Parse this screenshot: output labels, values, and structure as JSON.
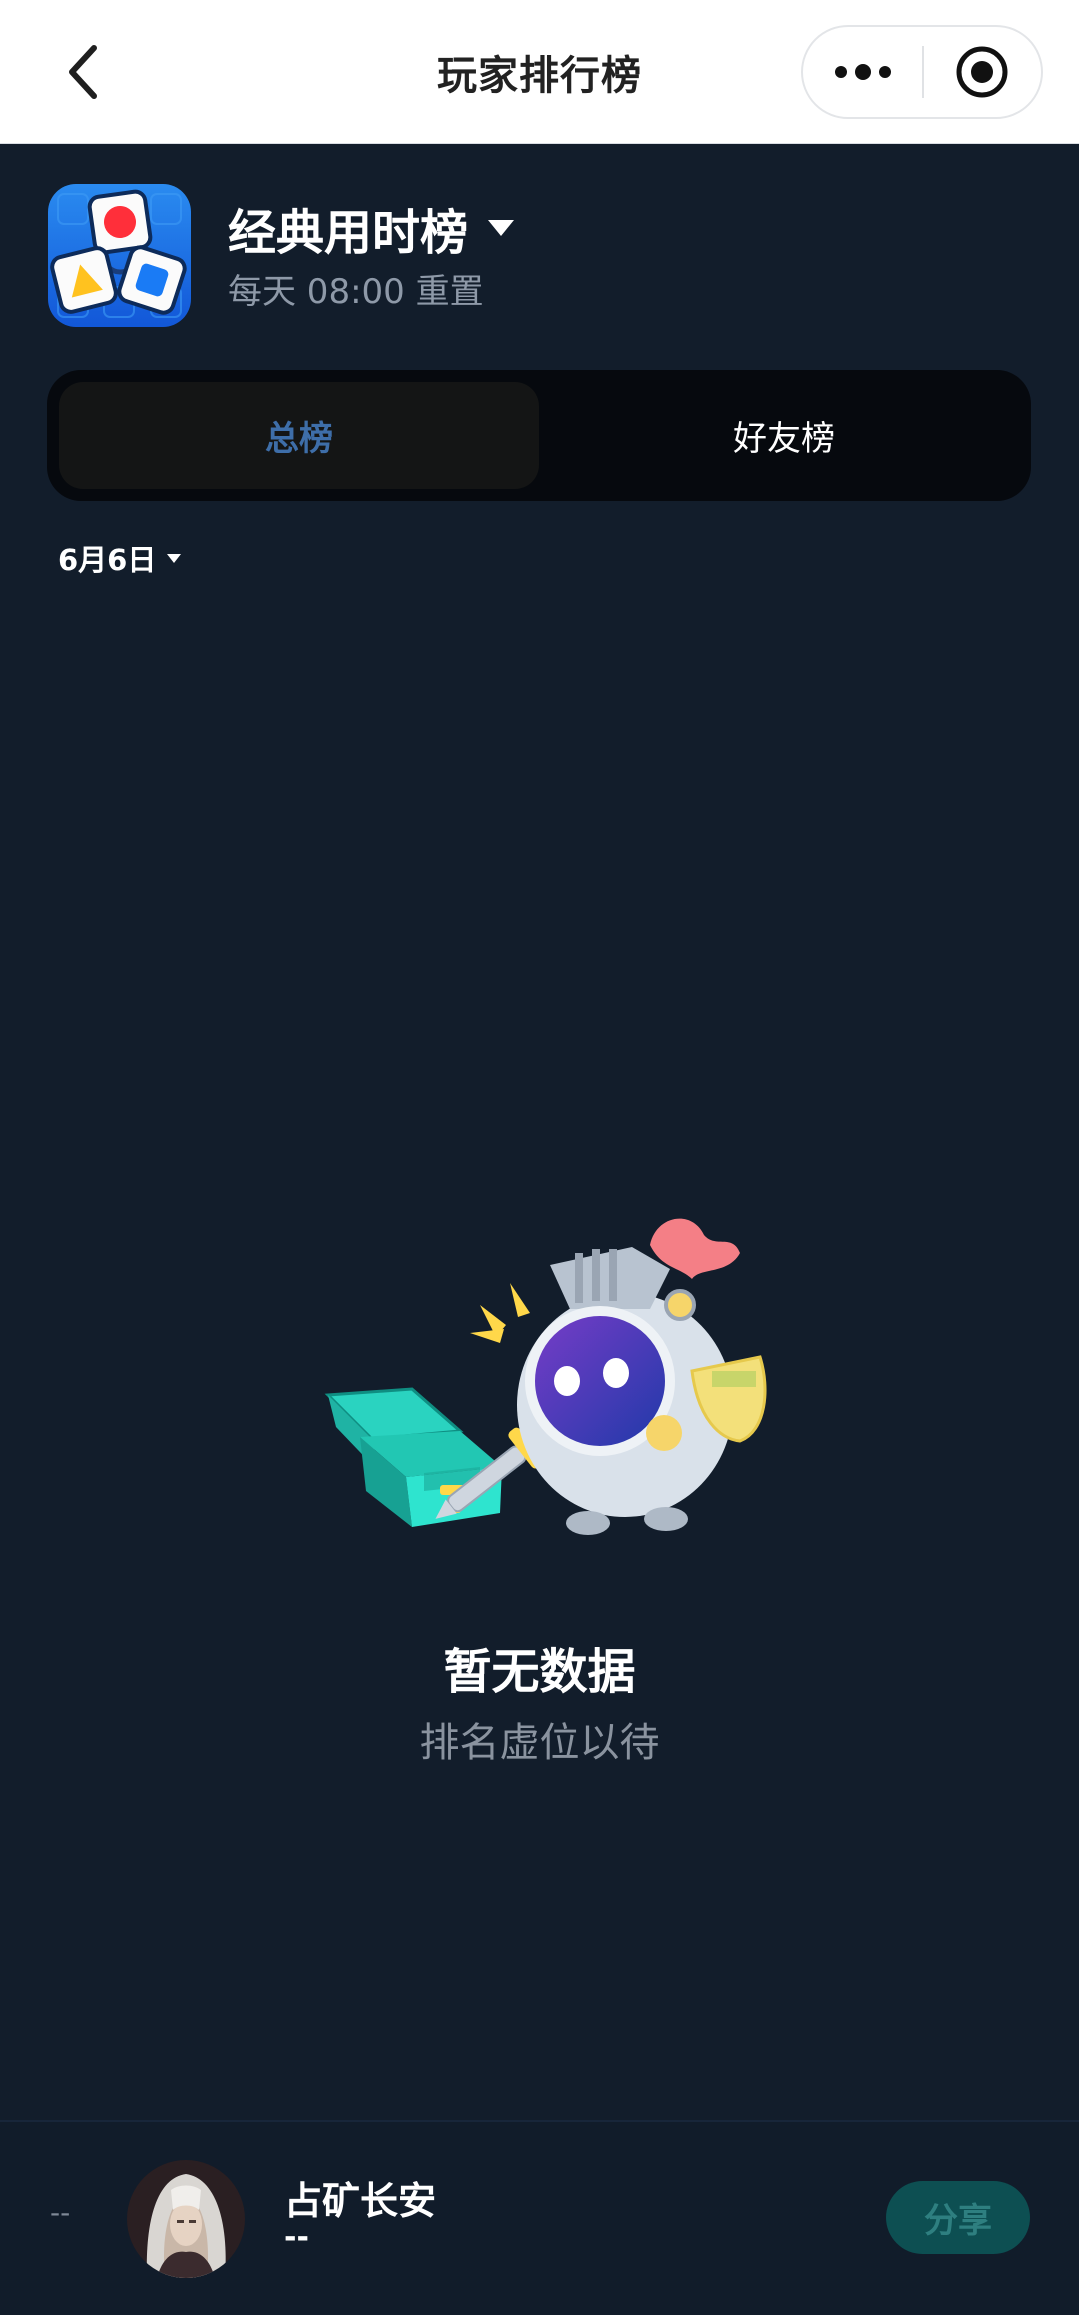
{
  "nav": {
    "title": "玩家排行榜",
    "back_icon": "chevron-left-icon",
    "more_icon": "more-dots-icon",
    "close_icon": "target-close-icon"
  },
  "board": {
    "title": "经典用时榜",
    "reset_text": "每天 08:00 重置"
  },
  "tabs": [
    {
      "label": "总榜",
      "active": true
    },
    {
      "label": "好友榜",
      "active": false
    }
  ],
  "date_filter": {
    "value": "6月6日"
  },
  "empty_state": {
    "title": "暂无数据",
    "subtitle": "排名虚位以待"
  },
  "me": {
    "rank": "--",
    "name": "占矿长安",
    "score": "--",
    "share_label": "分享"
  },
  "colors": {
    "background": "#121d2b",
    "tab_active_text": "#3e6ea9",
    "share_button": "#0d4f52"
  }
}
